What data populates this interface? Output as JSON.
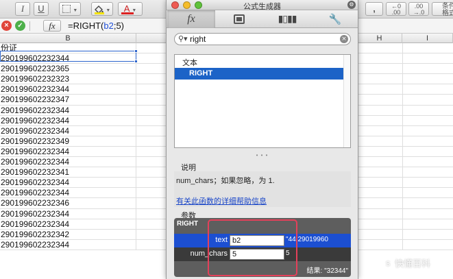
{
  "toolbar": {
    "italic": "I",
    "underline": "U",
    "font_color_glyph": "A",
    "comma_glyph": ",",
    "increase_decimal": "←0\n.00",
    "decrease_decimal": ".00\n→.0",
    "conditional_format_l1": "条件",
    "conditional_format_l2": "格式"
  },
  "formula_bar": {
    "fx": "fx",
    "formula_prefix": "=RIGHT(",
    "formula_ref": "b2",
    "formula_suffix": ";5)"
  },
  "sheet": {
    "col_b": "B",
    "col_h": "H",
    "col_i": "I",
    "rows": [
      "份证",
      "290199602232344",
      "290199602232365",
      "290199602232323",
      "290199602232344",
      "290199602232347",
      "290199602232344",
      "290199602232344",
      "290199602232344",
      "290199602232349",
      "290199602232344",
      "290199602232344",
      "290199602232341",
      "290199602232344",
      "290199602232344",
      "290199602232346",
      "290199602232344",
      "290199602232344",
      "290199602232342",
      "290199602232344"
    ]
  },
  "panel": {
    "title": "公式生成器",
    "tab_fx": "fx",
    "search_value": "right",
    "category": "文本",
    "selected_function": "RIGHT",
    "splitter": "• • •",
    "description_label": "说明",
    "description_text": "num_chars；如果忽略，为 1.",
    "help_link": "有关此函数的详细帮助信息",
    "args_label": "参数",
    "args_function": "RIGHT",
    "args": [
      {
        "name": "text",
        "value": "b2",
        "result": "\"44 29019960"
      },
      {
        "name": "num_chars",
        "value": "5",
        "result": "5"
      }
    ],
    "final_result": "结果: \"32344\""
  },
  "watermark": "快懂百科",
  "colors": {
    "selection_blue": "#1c63c7",
    "arg_row_blue": "#1c4fd1",
    "highlight_red": "#e5405a",
    "link_blue": "#1a46c8"
  }
}
